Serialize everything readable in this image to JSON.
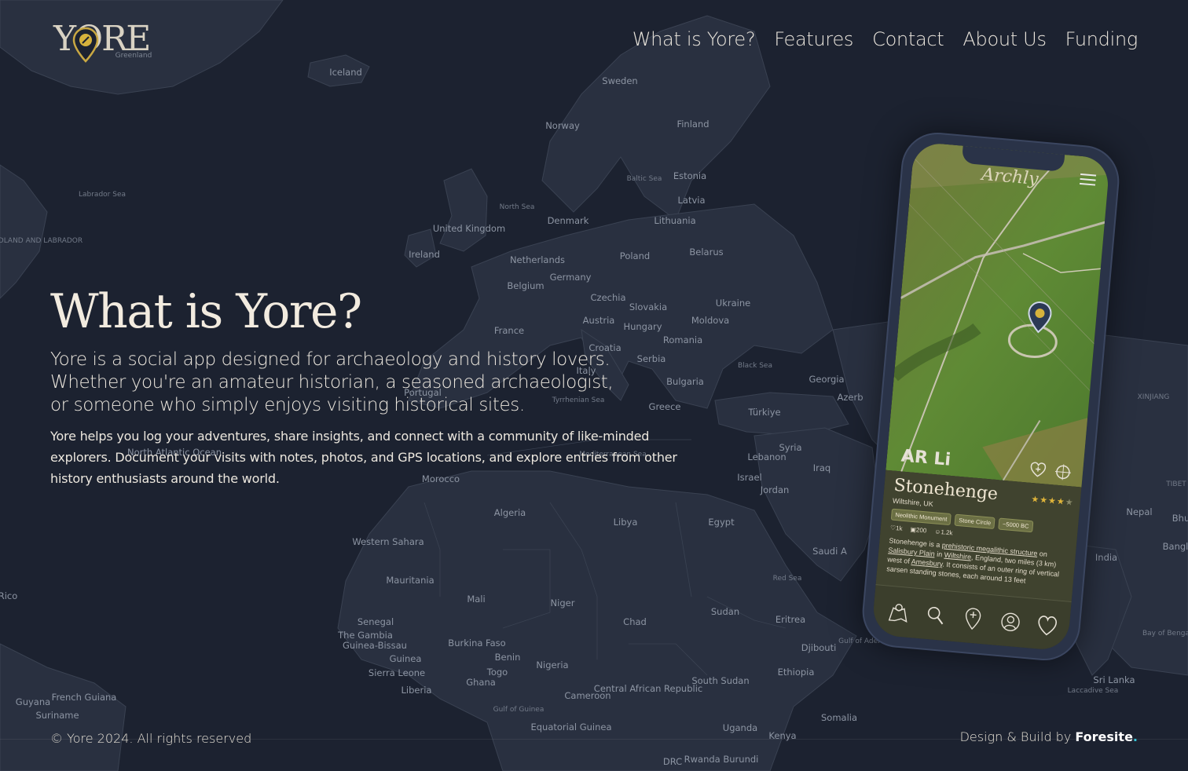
{
  "header": {
    "logo_text": "YORE",
    "nav": [
      {
        "label": "What is Yore?"
      },
      {
        "label": "Features"
      },
      {
        "label": "Contact"
      },
      {
        "label": "About Us"
      },
      {
        "label": "Funding"
      }
    ]
  },
  "hero": {
    "title": "What is Yore?",
    "lead": "Yore is a social app designed for archaeology and history lovers. Whether you're an amateur historian, a seasoned archaeologist, or someone who simply enjoys visiting historical sites.",
    "body": "Yore helps you log your adventures, share insights, and connect with a community of like-minded explorers. Document your visits with notes, photos, and GPS locations, and explore entries from other history enthusiasts around the world."
  },
  "phone": {
    "app_logo": "Archly",
    "ar_label": "AR Li",
    "site_name": "Stonehenge",
    "site_location": "Wiltshire, UK",
    "rating": 4,
    "tags": [
      "Neolithic Monument",
      "Stone Circle",
      "~5000 BC"
    ],
    "stats": {
      "likes": "1k",
      "photos": "200",
      "visitors": "1.2k"
    },
    "description": {
      "p1": "Stonehenge is a ",
      "link1": "prehistoric megalithic structure",
      "p2": " on ",
      "link2": "Salisbury Plain",
      "p3": " in ",
      "link3": "Wiltshire",
      "p4": ", England, two miles (3 km) west of ",
      "link4": "Amesbury",
      "p5": ". It consists of an outer ring of vertical sarsen standing stones, each around 13 feet"
    },
    "tabs": [
      "map-icon",
      "search-icon",
      "add-pin-icon",
      "profile-icon",
      "heart-icon"
    ]
  },
  "map_labels": [
    {
      "text": "Greenland"
    },
    {
      "text": "Iceland"
    },
    {
      "text": "Sweden"
    },
    {
      "text": "Norway"
    },
    {
      "text": "Finland"
    },
    {
      "text": "Labrador Sea"
    },
    {
      "text": "Estonia"
    },
    {
      "text": "Baltic Sea"
    },
    {
      "text": "Latvia"
    },
    {
      "text": "North Sea"
    },
    {
      "text": "Denmark"
    },
    {
      "text": "Lithuania"
    },
    {
      "text": "United Kingdom"
    },
    {
      "text": "NEWFOUNDLAND AND LABRADOR"
    },
    {
      "text": "Ireland"
    },
    {
      "text": "Netherlands"
    },
    {
      "text": "Poland"
    },
    {
      "text": "Belarus"
    },
    {
      "text": "Belgium"
    },
    {
      "text": "Germany"
    },
    {
      "text": "Czechia"
    },
    {
      "text": "Ukraine"
    },
    {
      "text": "Slovakia"
    },
    {
      "text": "France"
    },
    {
      "text": "Austria"
    },
    {
      "text": "Hungary"
    },
    {
      "text": "Moldova"
    },
    {
      "text": "Romania"
    },
    {
      "text": "Croatia"
    },
    {
      "text": "Serbia"
    },
    {
      "text": "Black Sea"
    },
    {
      "text": "Georgia"
    },
    {
      "text": "Italy"
    },
    {
      "text": "Bulgaria"
    },
    {
      "text": "Portugal"
    },
    {
      "text": "Tyrrhenian Sea"
    },
    {
      "text": "Greece"
    },
    {
      "text": "Azerb"
    },
    {
      "text": "Türkiye"
    },
    {
      "text": "XINJIANG"
    },
    {
      "text": "Syria"
    },
    {
      "text": "Lebanon"
    },
    {
      "text": "Morocco"
    },
    {
      "text": "Iraq"
    },
    {
      "text": "Israel"
    },
    {
      "text": "Jordan"
    },
    {
      "text": "TIBET"
    },
    {
      "text": "Nepal"
    },
    {
      "text": "Bhu"
    },
    {
      "text": "Algeria"
    },
    {
      "text": "Libya"
    },
    {
      "text": "Egypt"
    },
    {
      "text": "Western Sahara"
    },
    {
      "text": "Saudi A"
    },
    {
      "text": "India"
    },
    {
      "text": "Bangl"
    },
    {
      "text": "Mauritania"
    },
    {
      "text": "Red Sea"
    },
    {
      "text": "Mali"
    },
    {
      "text": "Niger"
    },
    {
      "text": "Rico"
    },
    {
      "text": "Sudan"
    },
    {
      "text": "Senegal"
    },
    {
      "text": "Chad"
    },
    {
      "text": "Eritrea"
    },
    {
      "text": "The Gambia"
    },
    {
      "text": "Guinea-Bissau"
    },
    {
      "text": "Burkina Faso"
    },
    {
      "text": "Bay of Benga"
    },
    {
      "text": "Guinea"
    },
    {
      "text": "Benin"
    },
    {
      "text": "Gulf of Aden"
    },
    {
      "text": "Djibouti"
    },
    {
      "text": "Sierra Leone"
    },
    {
      "text": "Togo"
    },
    {
      "text": "Nigeria"
    },
    {
      "text": "Ethiopia"
    },
    {
      "text": "Ghana"
    },
    {
      "text": "Central African Republic"
    },
    {
      "text": "South Sudan"
    },
    {
      "text": "Sri Lanka"
    },
    {
      "text": "Liberia"
    },
    {
      "text": "Laccadive Sea"
    },
    {
      "text": "Guyana"
    },
    {
      "text": "French Guiana"
    },
    {
      "text": "Cameroon"
    },
    {
      "text": "Suriname"
    },
    {
      "text": "Gulf of Guinea"
    },
    {
      "text": "Somalia"
    },
    {
      "text": "Equatorial Guinea"
    },
    {
      "text": "Uganda"
    },
    {
      "text": "Kenya"
    },
    {
      "text": "DRC"
    },
    {
      "text": "Rwanda Burundi"
    },
    {
      "text": "North Atlantic Ocean"
    },
    {
      "text": "Mediterranean Sea"
    }
  ],
  "footer": {
    "copyright": "© Yore 2024. All rights reserved",
    "credit_prefix": "Design & Build by ",
    "credit_brand": "Foresite",
    "credit_dot": "."
  },
  "colors": {
    "background": "#1c2230",
    "land": "#2a3140",
    "text": "#ece7de",
    "accent_gold": "#e0b53a",
    "credit_accent": "#36c6d8"
  }
}
